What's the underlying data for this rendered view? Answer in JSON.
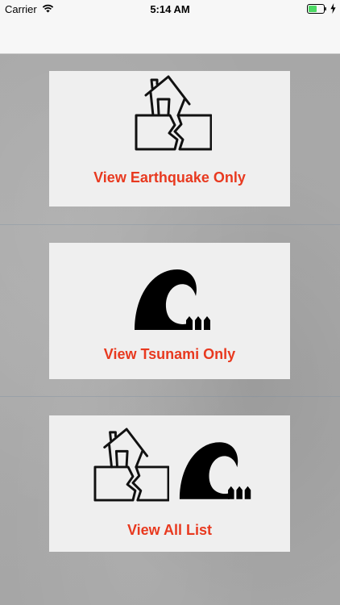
{
  "status_bar": {
    "carrier": "Carrier",
    "time": "5:14 AM",
    "battery_color": "#4cd964"
  },
  "cards": [
    {
      "label": "View Earthquake Only",
      "icon": "earthquake-house-icon"
    },
    {
      "label": "View Tsunami Only",
      "icon": "tsunami-wave-icon"
    },
    {
      "label": "View All List",
      "icons": [
        "earthquake-house-icon",
        "tsunami-wave-icon"
      ]
    }
  ],
  "colors": {
    "label": "#e8391f",
    "card_background": "#efefef"
  }
}
